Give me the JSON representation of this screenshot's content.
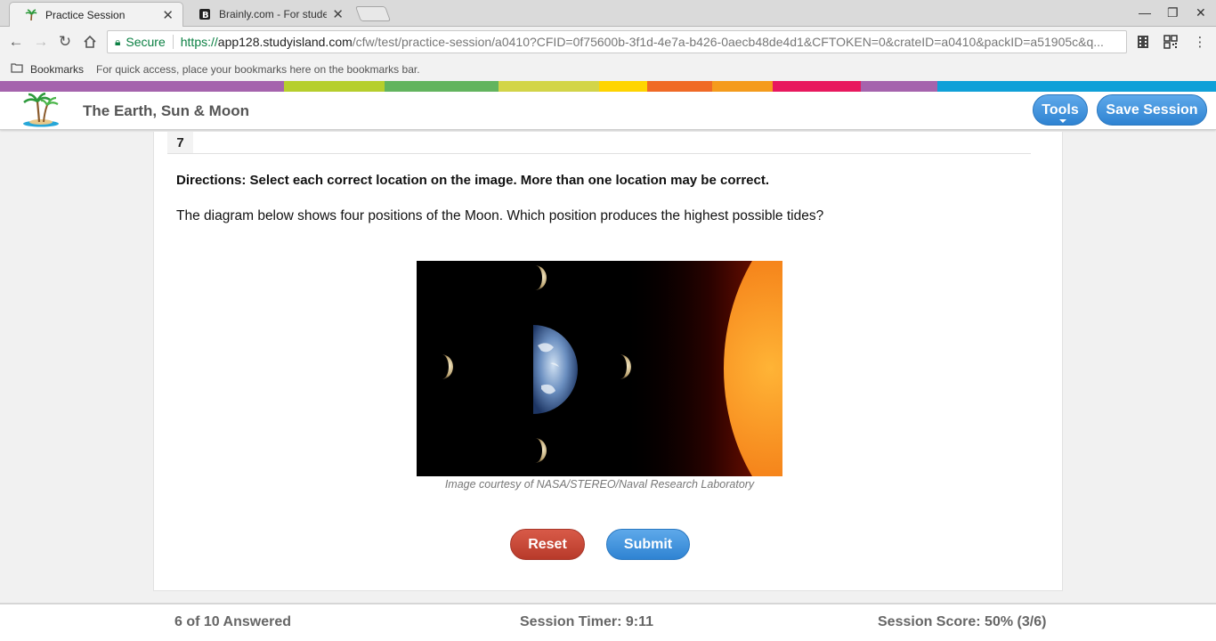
{
  "browser": {
    "tabs": [
      {
        "title": "Practice Session",
        "favicon": "palm-tree-icon",
        "active": true
      },
      {
        "title": "Brainly.com - For studen",
        "favicon": "brainly-icon",
        "active": false
      }
    ],
    "address": {
      "secure_label": "Secure",
      "url_scheme": "https://",
      "url_host": "app128.studyisland.com",
      "url_rest": "/cfw/test/practice-session/a0410?CFID=0f75600b-3f1d-4e7a-b426-0aecb48de4d1&CFTOKEN=0&crateID=a0410&packID=a51905c&q..."
    },
    "bookmarks": {
      "label": "Bookmarks",
      "hint": "For quick access, place your bookmarks here on the bookmarks bar."
    }
  },
  "colors": {
    "stripe": [
      "#a563ad",
      "#b6cf2c",
      "#62b45e",
      "#d3d548",
      "#ffd500",
      "#f06a25",
      "#f59b1c",
      "#e8185e",
      "#a563ad",
      "#0fa0d8"
    ],
    "accent_blue": "#2f83d2",
    "reset_red": "#c2412f"
  },
  "app": {
    "title": "The Earth, Sun & Moon",
    "tools_label": "Tools",
    "save_label": "Save Session"
  },
  "question": {
    "number": "7",
    "directions": "Directions: Select each correct location on the image. More than one location may be correct.",
    "prompt": "The diagram below shows four positions of the Moon. Which position produces the highest possible tides?",
    "image_caption": "Image courtesy of NASA/STEREO/Naval Research Laboratory",
    "reset_label": "Reset",
    "submit_label": "Submit"
  },
  "footer": {
    "answered": "6 of 10 Answered",
    "timer": "Session Timer: 9:11",
    "score": "Session Score: 50% (3/6)"
  }
}
